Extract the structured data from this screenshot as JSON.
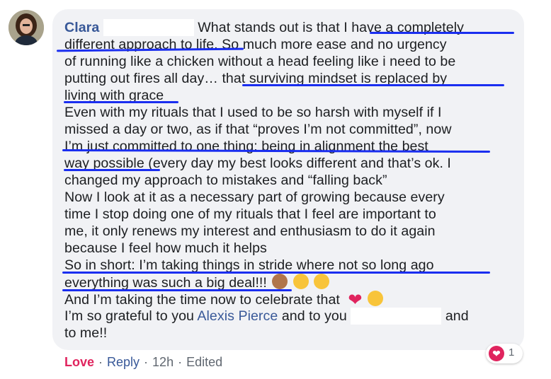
{
  "comment": {
    "author": "Clara",
    "lines": [
      "What stands out is that I have a completely",
      "different approach to life. So much more ease and no urgency",
      "of running like a chicken without a head feeling like i need to be",
      "putting out fires all day… that surviving mindset is replaced by",
      "living with grace",
      "Even with my rituals that I used to be so harsh with myself if I",
      "missed a day or two, as if that “proves I’m not committed”, now",
      "I’m just committed to one thing: being in alignment the best",
      "way possible (every day my best looks different and that’s ok. I",
      "changed my approach to mistakes and “falling back”",
      "Now I look at it as a necessary part of growing because every",
      "time I stop doing one of my rituals that I feel are important to",
      "me, it only renews my interest and enthusiasm to do it again",
      "because I feel how much it helps",
      "So in short: I’m taking things in stride where not so long ago",
      "everything was such a big deal!!!",
      "And I’m taking the time now to celebrate that"
    ],
    "last_line_prefix": "I’m so grateful to you",
    "mention": "Alexis Pierce",
    "last_line_mid": "and to you",
    "last_line_end": "and",
    "final_line": "to me!!"
  },
  "reaction": {
    "icon": "heart-icon",
    "count": "1"
  },
  "actions": {
    "love": "Love",
    "reply": "Reply",
    "time": "12h",
    "edited": "Edited",
    "separator": "·"
  },
  "colors": {
    "link": "#385898",
    "love": "#e0245e",
    "highlight": "#1a2ef0",
    "bubble": "#f1f2f5"
  }
}
